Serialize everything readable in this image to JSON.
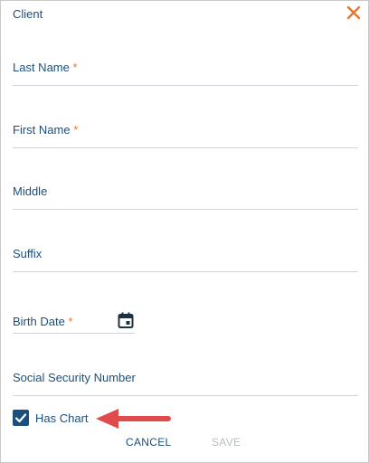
{
  "dialog": {
    "title": "Client",
    "close_icon": "close-x-icon",
    "accent_color": "#e8772e",
    "primary_color": "#1b4f7d"
  },
  "fields": {
    "last_name": {
      "label": "Last Name",
      "required_mark": "*",
      "value": ""
    },
    "first_name": {
      "label": "First Name",
      "required_mark": "*",
      "value": ""
    },
    "middle": {
      "label": "Middle",
      "value": ""
    },
    "suffix": {
      "label": "Suffix",
      "value": ""
    },
    "birth_date": {
      "label": "Birth Date",
      "required_mark": "*",
      "value": "",
      "icon": "calendar-icon"
    },
    "ssn": {
      "label": "Social Security Number",
      "value": ""
    }
  },
  "has_chart": {
    "label": "Has Chart",
    "checked": true
  },
  "annotation": {
    "arrow_color": "#e04b4b",
    "icon": "red-arrow-icon"
  },
  "actions": {
    "cancel_label": "CANCEL",
    "save_label": "SAVE"
  }
}
